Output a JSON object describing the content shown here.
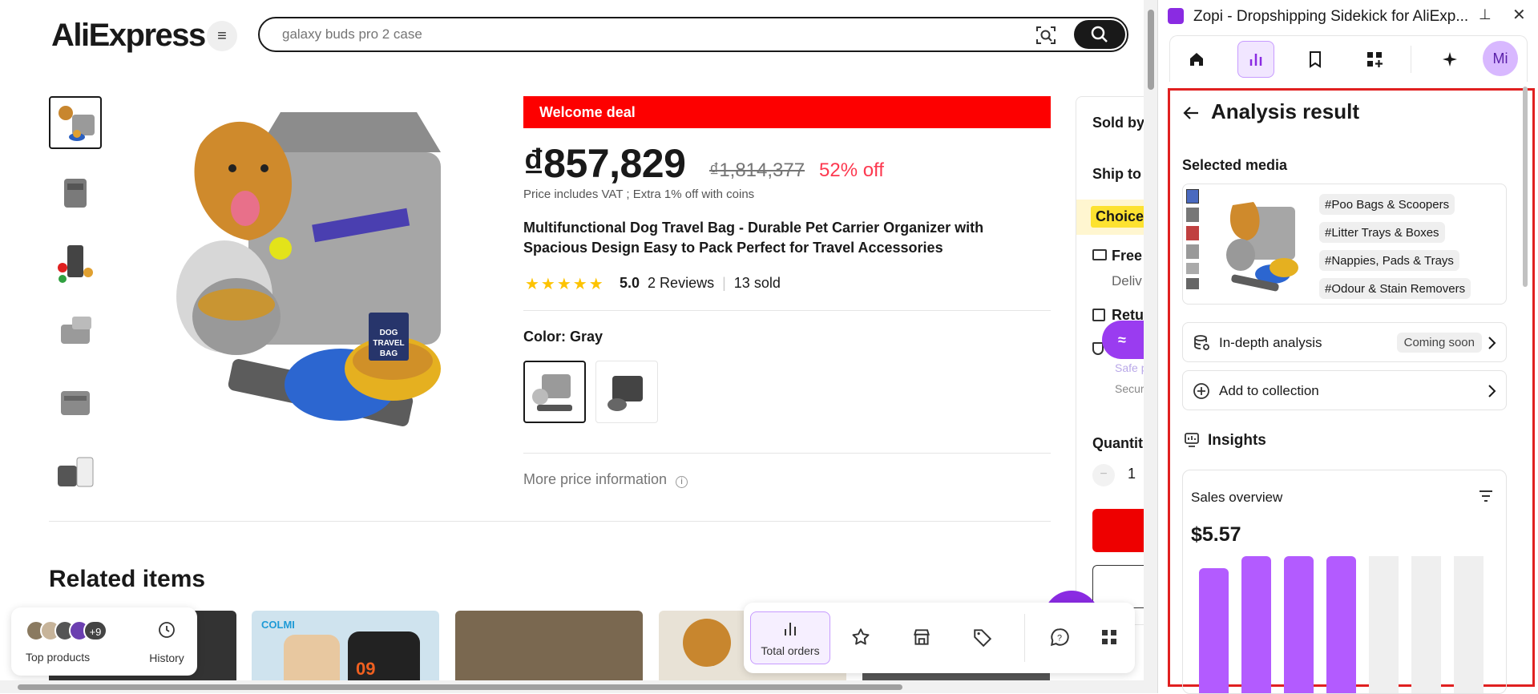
{
  "header": {
    "logo": "AliExpress",
    "search_placeholder": "galaxy buds pro 2 case"
  },
  "product": {
    "deal_banner": "Welcome deal",
    "price": "₫857,829",
    "old_price": "₫1,814,377",
    "discount": "52% off",
    "vat_note": "Price includes VAT ; Extra 1% off with coins",
    "title": "Multifunctional Dog Travel Bag - Durable Pet Carrier Organizer with Spacious Design Easy to Pack Perfect for Travel Accessories",
    "stars": "★★★★★",
    "rating": "5.0",
    "reviews": "2 Reviews",
    "sold": "13 sold",
    "color_label": "Color: Gray",
    "more_price": "More price information",
    "image_text": "DOG TRAVEL BAG"
  },
  "side_box": {
    "sold_by": "Sold by",
    "ship_to": "Ship to",
    "choice": "Choice",
    "free": "Free",
    "deliv": "Deliv",
    "return": "Retur",
    "safe": "Safe p",
    "secure": "Secur",
    "quantity_label": "Quantit",
    "quantity_value": "1"
  },
  "related": {
    "title": "Related items",
    "card2_brand": "COLMI",
    "card2_time": "09"
  },
  "bottom_left": {
    "plus_count": "+9",
    "top_products": "Top products",
    "history": "History"
  },
  "toolbar": {
    "total_orders": "Total orders"
  },
  "panel": {
    "window_title": "Zopi - Dropshipping Sidekick for AliExp...",
    "avatar": "Mi",
    "heading": "Analysis result",
    "selected_media": "Selected media",
    "tags": [
      "#Poo Bags & Scoopers",
      "#Litter Trays & Boxes",
      "#Nappies, Pads & Trays",
      "#Odour & Stain Removers"
    ],
    "in_depth": "In-depth analysis",
    "coming_soon": "Coming soon",
    "add_collection": "Add to collection",
    "insights": "Insights",
    "sales_overview": "Sales overview",
    "sales_value": "$5.57"
  },
  "chart_data": {
    "type": "bar",
    "title": "Sales overview",
    "values": [
      0.88,
      0.96,
      0.96,
      0.96,
      0,
      0,
      0
    ],
    "colors": [
      "#b35bff",
      "#b35bff",
      "#b35bff",
      "#b35bff",
      "#efefef",
      "#efefef",
      "#efefef"
    ]
  }
}
